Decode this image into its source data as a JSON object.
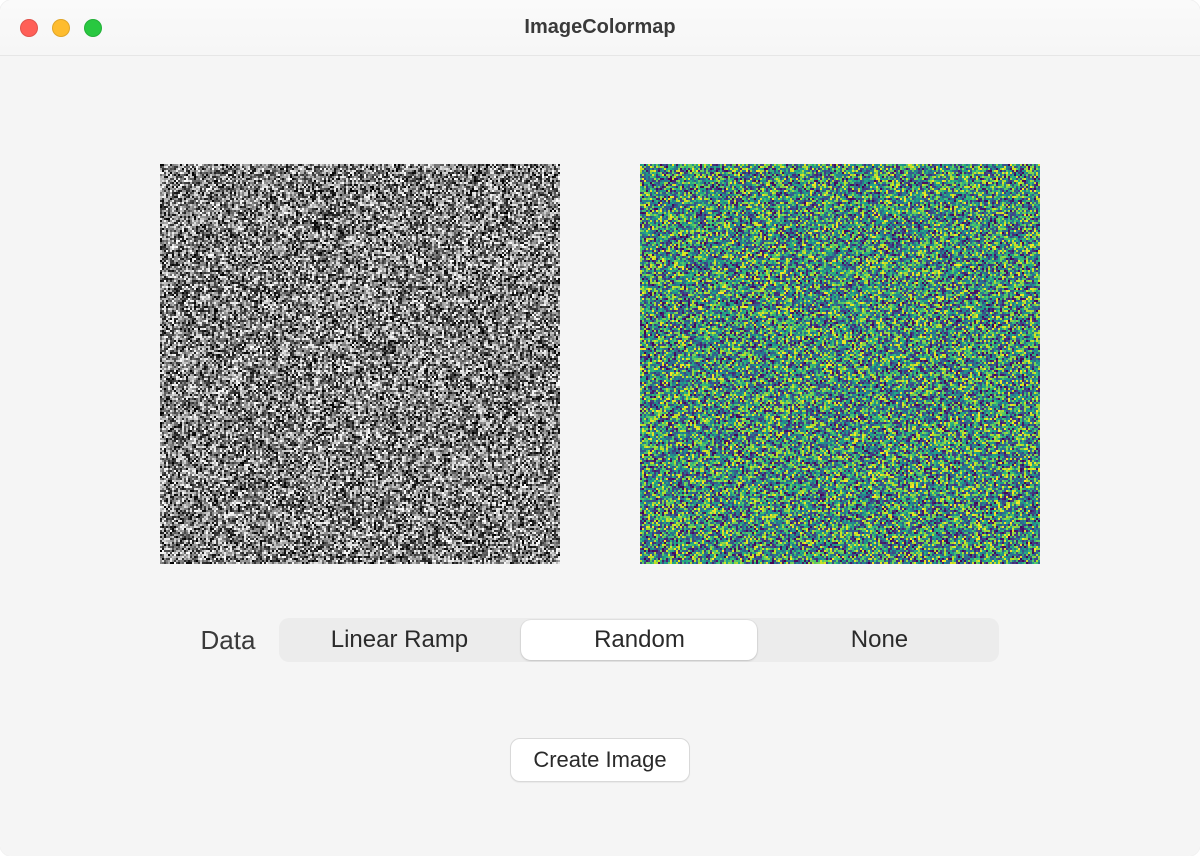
{
  "window": {
    "title": "ImageColormap"
  },
  "images": {
    "left": {
      "type": "grayscale-noise",
      "size": 200
    },
    "right": {
      "type": "viridis-noise",
      "size": 200
    }
  },
  "controls": {
    "data_label": "Data",
    "segments": [
      {
        "label": "Linear Ramp",
        "selected": false
      },
      {
        "label": "Random",
        "selected": true
      },
      {
        "label": "None",
        "selected": false
      }
    ]
  },
  "button": {
    "create_label": "Create Image"
  }
}
